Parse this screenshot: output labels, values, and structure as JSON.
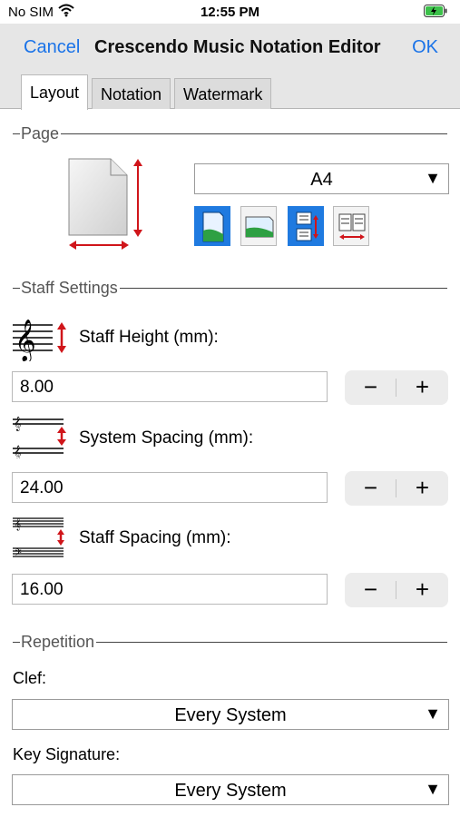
{
  "status_bar": {
    "carrier": "No SIM",
    "time": "12:55 PM",
    "wifi_icon": "wifi-icon",
    "battery_icon": "battery-charging-icon"
  },
  "nav": {
    "cancel_label": "Cancel",
    "title": "Crescendo Music Notation Editor",
    "ok_label": "OK",
    "accent_color": "#1a73e8"
  },
  "tabs": [
    {
      "label": "Layout",
      "active": true
    },
    {
      "label": "Notation",
      "active": false
    },
    {
      "label": "Watermark",
      "active": false
    }
  ],
  "page_section": {
    "header": "Page",
    "paper_size": "A4",
    "page_icon": "page-size-icon",
    "orientation_buttons": [
      {
        "name": "portrait-icon",
        "selected": true
      },
      {
        "name": "landscape-icon",
        "selected": false
      },
      {
        "name": "fit-vertical-icon",
        "selected": true
      },
      {
        "name": "fit-horizontal-icon",
        "selected": false
      }
    ]
  },
  "staff_section": {
    "header": "Staff Settings",
    "staff_height": {
      "label": "Staff Height (mm):",
      "value": "8.00",
      "icon": "staff-height-icon"
    },
    "system_spacing": {
      "label": "System Spacing (mm):",
      "value": "24.00",
      "icon": "system-spacing-icon"
    },
    "staff_spacing": {
      "label": "Staff Spacing (mm):",
      "value": "16.00",
      "icon": "staff-spacing-icon"
    },
    "minus_label": "−",
    "plus_label": "+"
  },
  "repetition_section": {
    "header": "Repetition",
    "clef_label": "Clef:",
    "clef_value": "Every System",
    "key_signature_label": "Key Signature:",
    "key_signature_value": "Every System"
  },
  "dropdown_arrow": "▼"
}
